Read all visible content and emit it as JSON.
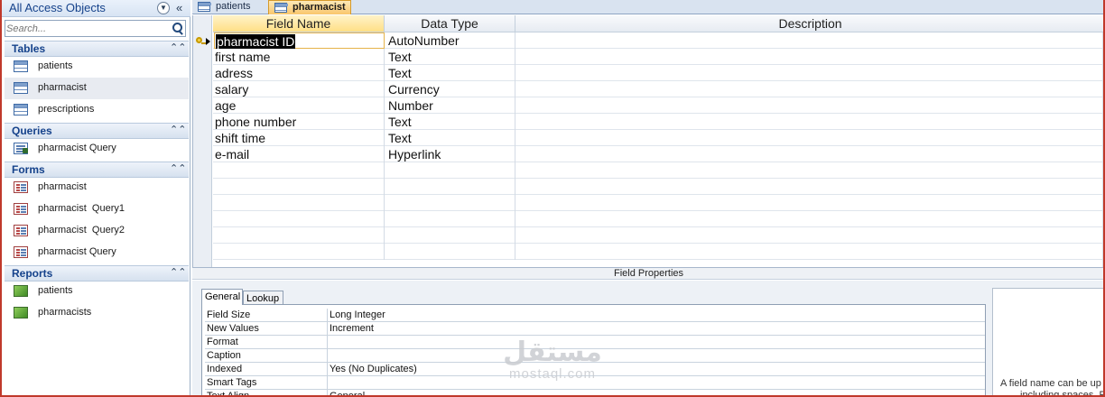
{
  "nav": {
    "title": "All Access Objects",
    "search_placeholder": "Search...",
    "groups": [
      {
        "label": "Tables",
        "items": [
          "patients",
          "pharmacist",
          "prescriptions"
        ]
      },
      {
        "label": "Queries",
        "items": [
          "pharmacist Query"
        ]
      },
      {
        "label": "Forms",
        "items": [
          "pharmacist",
          "pharmacist  Query1",
          "pharmacist  Query2",
          "pharmacist Query"
        ]
      },
      {
        "label": "Reports",
        "items": [
          "patients",
          "pharmacists"
        ]
      }
    ]
  },
  "tabs": [
    {
      "label": "patients"
    },
    {
      "label": "pharmacist",
      "active": true
    }
  ],
  "design": {
    "headers": {
      "field_name": "Field Name",
      "data_type": "Data Type",
      "description": "Description"
    },
    "rows": [
      {
        "field": "pharmacist ID",
        "type": "AutoNumber",
        "primary_key": true
      },
      {
        "field": "first name",
        "type": "Text"
      },
      {
        "field": "adress",
        "type": "Text"
      },
      {
        "field": "salary",
        "type": "Currency"
      },
      {
        "field": "age",
        "type": "Number"
      },
      {
        "field": "phone number",
        "type": "Text"
      },
      {
        "field": "shift time",
        "type": "Text"
      },
      {
        "field": "e-mail",
        "type": "Hyperlink"
      }
    ]
  },
  "field_properties": {
    "title": "Field Properties",
    "tabs": [
      "General",
      "Lookup"
    ],
    "props": [
      {
        "k": "Field Size",
        "v": "Long Integer"
      },
      {
        "k": "New Values",
        "v": "Increment"
      },
      {
        "k": "Format",
        "v": ""
      },
      {
        "k": "Caption",
        "v": ""
      },
      {
        "k": "Indexed",
        "v": "Yes (No Duplicates)"
      },
      {
        "k": "Smart Tags",
        "v": ""
      },
      {
        "k": "Text Align",
        "v": "General"
      }
    ],
    "help_line1": "A field name can be up",
    "help_line2": "including spaces. Pre"
  },
  "watermark": {
    "arabic": "مستقل",
    "latin": "mostaql.com"
  },
  "colors": {
    "accent": "#15428b",
    "active_tab": "#f9c66c",
    "frame": "#c0392b"
  }
}
